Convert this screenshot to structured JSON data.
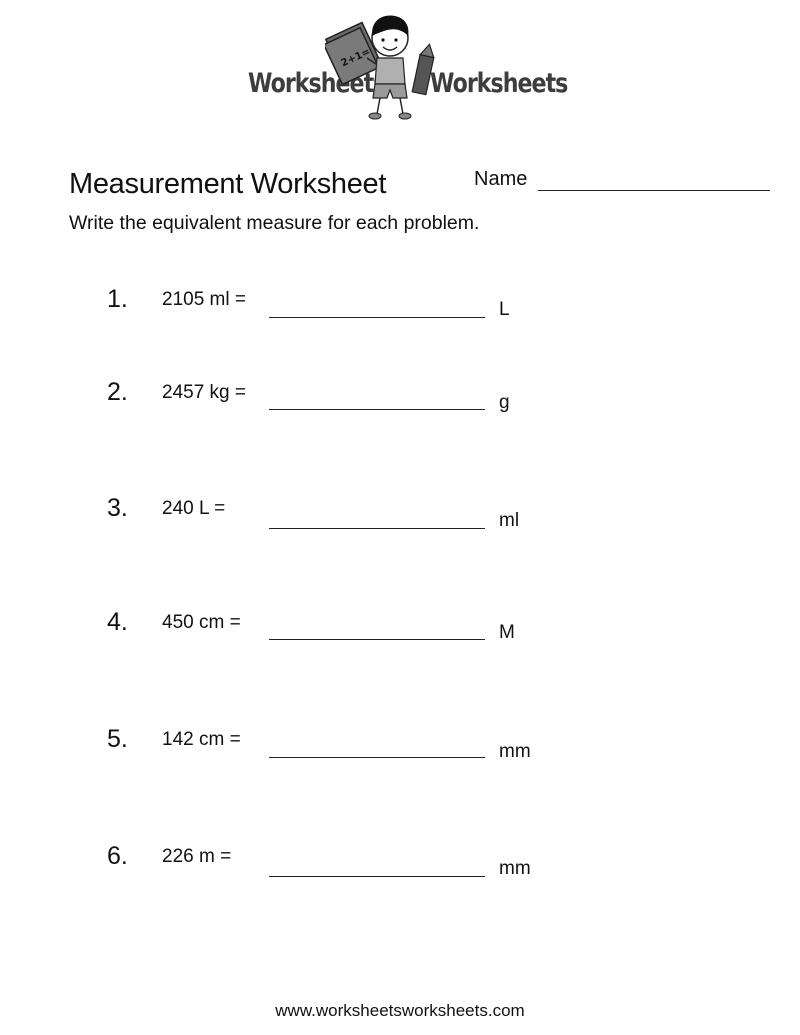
{
  "logo": {
    "left_word": "Worksheets",
    "right_word": "Worksheets",
    "book_text": "2+1="
  },
  "header": {
    "title": "Measurement Worksheet",
    "name_label": "Name"
  },
  "instructions": "Write the equivalent measure for each problem.",
  "problems": [
    {
      "number": "1.",
      "expression": "2105 ml =",
      "answer": "",
      "unit": "L"
    },
    {
      "number": "2.",
      "expression": "2457 kg =",
      "answer": "",
      "unit": "g"
    },
    {
      "number": "3.",
      "expression": "240 L =",
      "answer": "",
      "unit": "ml"
    },
    {
      "number": "4.",
      "expression": "450 cm =",
      "answer": "",
      "unit": "M"
    },
    {
      "number": "5.",
      "expression": "142 cm =",
      "answer": "",
      "unit": "mm"
    },
    {
      "number": "6.",
      "expression": "226 m =",
      "answer": "",
      "unit": "mm"
    }
  ],
  "footer": {
    "url": "www.worksheetsworksheets.com"
  }
}
